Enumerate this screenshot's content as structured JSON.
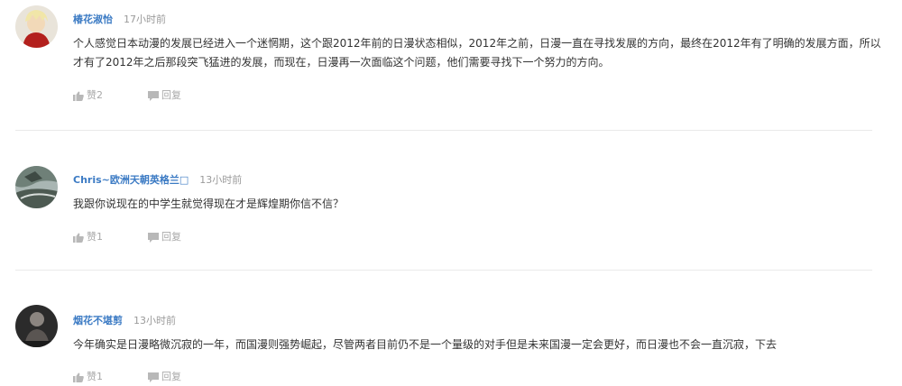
{
  "comments": [
    {
      "username": "椿花淑怡",
      "time": "17小时前",
      "text": "个人感觉日本动漫的发展已经进入一个迷惘期，这个跟2012年前的日漫状态相似，2012年之前，日漫一直在寻找发展的方向，最终在2012年有了明确的发展方面，所以才有了2012年之后那段突飞猛进的发展，而现在，日漫再一次面临这个问题，他们需要寻找下一个努力的方向。",
      "like_label": "赞2",
      "reply_label": "回复"
    },
    {
      "username": "Chris~欧洲天朝英格兰□",
      "time": "13小时前",
      "text": "我跟你说现在的中学生就觉得现在才是辉煌期你信不信？",
      "like_label": "赞1",
      "reply_label": "回复"
    },
    {
      "username": "烟花不堪剪",
      "time": "13小时前",
      "text": "今年确实是日漫略微沉寂的一年，而国漫则强势崛起，尽管两者目前仍不是一个量级的对手但是未来国漫一定会更好，而日漫也不会一直沉寂，下去",
      "like_label": "赞1",
      "reply_label": "回复"
    }
  ],
  "icons": {
    "like": "thumbs-up-icon",
    "reply": "speech-bubble-icon"
  },
  "colors": {
    "username": "#3c7bc4",
    "time": "#9a9a9a",
    "text": "#333333",
    "action": "#a8a8a8",
    "divider": "#eaeaea"
  }
}
